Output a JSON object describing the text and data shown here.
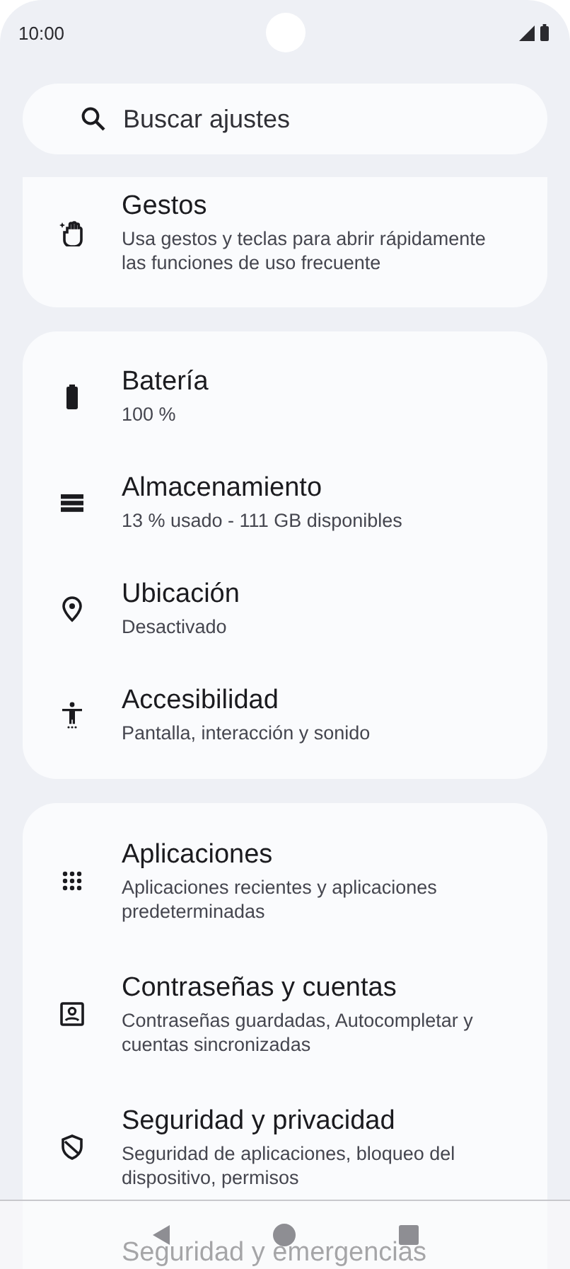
{
  "status_bar": {
    "time": "10:00"
  },
  "search": {
    "placeholder": "Buscar ajustes"
  },
  "groups": [
    {
      "clipped_top": true,
      "items": [
        {
          "kind": "gestures",
          "title": "Gestos",
          "subtitle": "Usa gestos y teclas para abrir rápidamente las funciones de uso frecuente"
        }
      ]
    },
    {
      "clipped_top": false,
      "items": [
        {
          "kind": "battery",
          "title": "Batería",
          "subtitle": "100 %"
        },
        {
          "kind": "storage",
          "title": "Almacenamiento",
          "subtitle": "13 % usado - 111 GB disponibles"
        },
        {
          "kind": "location",
          "title": "Ubicación",
          "subtitle": "Desactivado"
        },
        {
          "kind": "accessibility",
          "title": "Accesibilidad",
          "subtitle": "Pantalla, interacción y sonido"
        }
      ]
    },
    {
      "clipped_top": false,
      "items": [
        {
          "kind": "apps",
          "title": "Aplicaciones",
          "subtitle": "Aplicaciones recientes y aplicaciones predeterminadas"
        },
        {
          "kind": "accounts",
          "title": "Contraseñas y cuentas",
          "subtitle": "Contraseñas guardadas, Autocompletar y cuentas sincronizadas"
        },
        {
          "kind": "security",
          "title": "Seguridad y privacidad",
          "subtitle": "Seguridad de aplicaciones, bloqueo del dispositivo, permisos"
        },
        {
          "kind": "emergency",
          "title": "Seguridad y emergencias"
        }
      ]
    }
  ]
}
